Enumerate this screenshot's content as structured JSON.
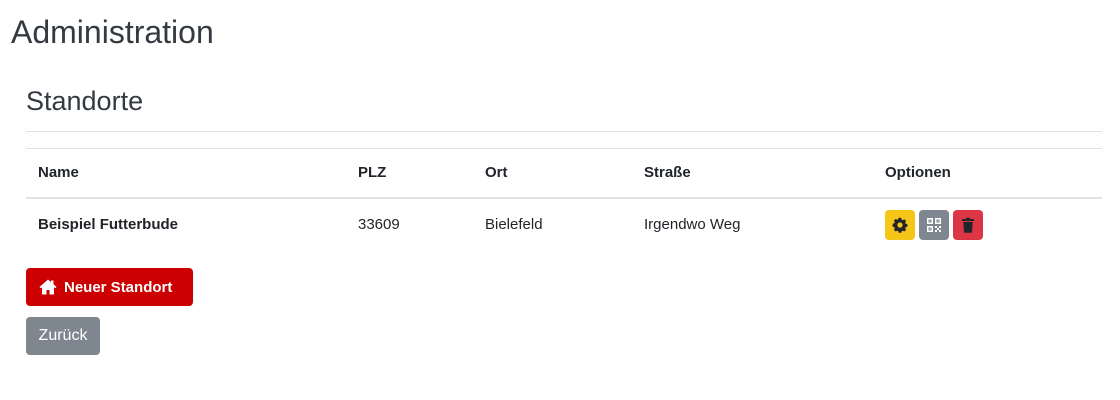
{
  "page": {
    "title": "Administration"
  },
  "section": {
    "title": "Standorte"
  },
  "table": {
    "headers": {
      "name": "Name",
      "plz": "PLZ",
      "ort": "Ort",
      "strasse": "Straße",
      "optionen": "Optionen"
    },
    "rows": [
      {
        "name": "Beispiel Futterbude",
        "plz": "33609",
        "ort": "Bielefeld",
        "strasse": "Irgendwo Weg"
      }
    ],
    "row_actions": [
      "gear-icon",
      "qrcode-icon",
      "trash-icon"
    ]
  },
  "buttons": {
    "new_location": "Neuer Standort",
    "new_location_icon": "home-icon",
    "back": "Zurück"
  },
  "colors": {
    "primary_red": "#cc0000",
    "warning": "#f5c518",
    "secondary": "#7e868f",
    "danger": "#dc3545"
  }
}
